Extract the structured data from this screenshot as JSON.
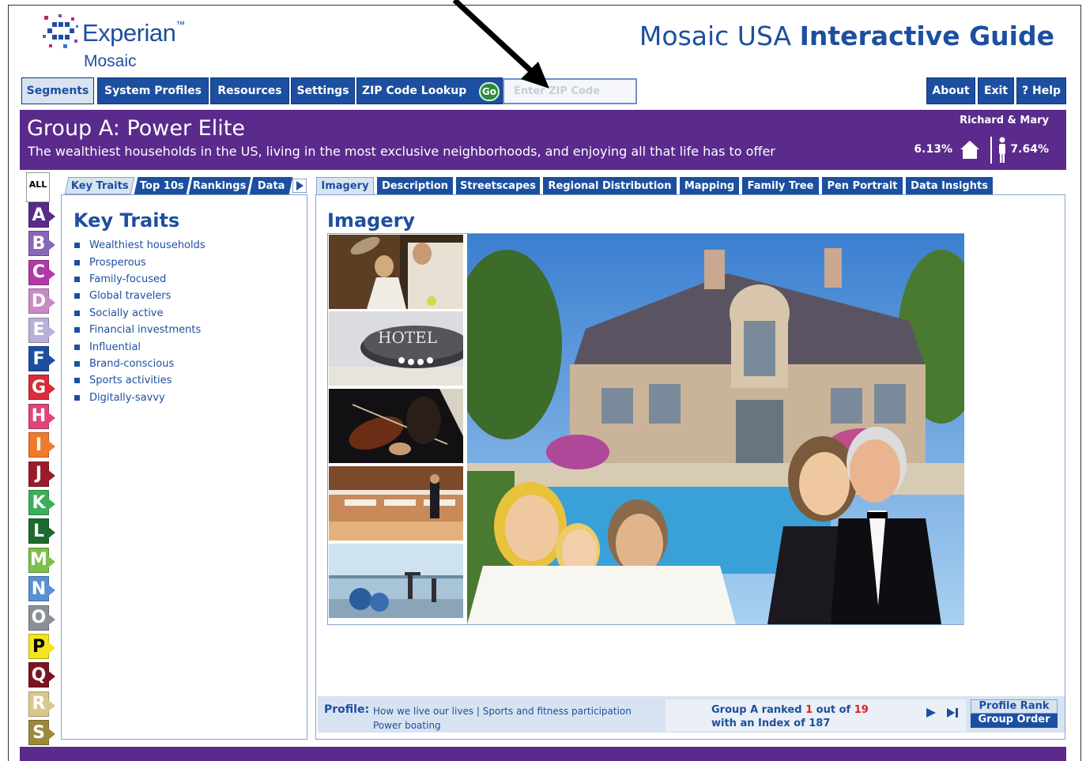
{
  "header": {
    "brand": "Experian",
    "brand_tm": "™",
    "product": "Mosaic",
    "title_regular": "Mosaic USA ",
    "title_bold": "Interactive Guide"
  },
  "nav": {
    "items": [
      {
        "label": "Segments",
        "active": true
      },
      {
        "label": "System Profiles",
        "active": false
      },
      {
        "label": "Resources",
        "active": false
      },
      {
        "label": "Settings",
        "active": false
      },
      {
        "label": "ZIP Code Lookup",
        "active": false
      }
    ],
    "go_label": "Go",
    "zip_placeholder": "Enter ZIP Code",
    "right_items": [
      {
        "label": "About"
      },
      {
        "label": "Exit"
      },
      {
        "label": "? Help"
      }
    ]
  },
  "group": {
    "title": "Group A: Power Elite",
    "description": "The wealthiest households in the US, living in the most exclusive neighborhoods, and enjoying all that life has to offer",
    "persona": "Richard & Mary",
    "households_pct": "6.13%",
    "population_pct": "7.64%"
  },
  "letters": {
    "all_label": "ALL",
    "items": [
      {
        "label": "A",
        "color": "#5a2a8c"
      },
      {
        "label": "B",
        "color": "#8a66b8"
      },
      {
        "label": "C",
        "color": "#b23aa6"
      },
      {
        "label": "D",
        "color": "#c98bc4"
      },
      {
        "label": "E",
        "color": "#b8b0d8"
      },
      {
        "label": "F",
        "color": "#1c4f9f"
      },
      {
        "label": "G",
        "color": "#d92b3a"
      },
      {
        "label": "H",
        "color": "#e0457a"
      },
      {
        "label": "I",
        "color": "#f07a2a"
      },
      {
        "label": "J",
        "color": "#9a1c2c"
      },
      {
        "label": "K",
        "color": "#3cae5a"
      },
      {
        "label": "L",
        "color": "#1c6b2f"
      },
      {
        "label": "M",
        "color": "#7cc04a"
      },
      {
        "label": "N",
        "color": "#5b8fd4"
      },
      {
        "label": "O",
        "color": "#8a8f98"
      },
      {
        "label": "P",
        "color": "#f3e51c"
      },
      {
        "label": "Q",
        "color": "#7a1424"
      },
      {
        "label": "R",
        "color": "#d8c88a"
      },
      {
        "label": "S",
        "color": "#9a8a3a"
      }
    ]
  },
  "left": {
    "tabs": [
      {
        "label": "Key Traits",
        "active": true
      },
      {
        "label": "Top 10s",
        "active": false
      },
      {
        "label": "Rankings",
        "active": false
      },
      {
        "label": "Data",
        "active": false
      }
    ],
    "heading": "Key Traits",
    "traits": [
      "Wealthiest households",
      "Prosperous",
      "Family-focused",
      "Global travelers",
      "Socially active",
      "Financial investments",
      "Influential",
      "Brand-conscious",
      "Sports activities",
      "Digitally-savvy"
    ]
  },
  "right": {
    "tabs": [
      {
        "label": "Imagery",
        "active": true
      },
      {
        "label": "Description",
        "active": false
      },
      {
        "label": "Streetscapes",
        "active": false
      },
      {
        "label": "Regional Distribution",
        "active": false
      },
      {
        "label": "Mapping",
        "active": false
      },
      {
        "label": "Family Tree",
        "active": false
      },
      {
        "label": "Pen Portrait",
        "active": false
      },
      {
        "label": "Data Insights",
        "active": false
      }
    ],
    "heading": "Imagery",
    "thumb_sign": "HOTEL"
  },
  "profile": {
    "label": "Profile:",
    "link1": "How we live our lives",
    "separator": "|",
    "link2": "Sports and fitness participation",
    "link3": "Power boating",
    "rank_prefix": "Group A ranked ",
    "rank_value": "1",
    "rank_mid": " out of ",
    "rank_total": "19",
    "rank_line2": "with an Index of 187",
    "profile_rank_btn": "Profile Rank",
    "group_order_btn": "Group Order"
  },
  "colors": {
    "brand_blue": "#1c4f9f",
    "band_purple": "#5a2a8c",
    "highlight_red": "#e02020"
  }
}
